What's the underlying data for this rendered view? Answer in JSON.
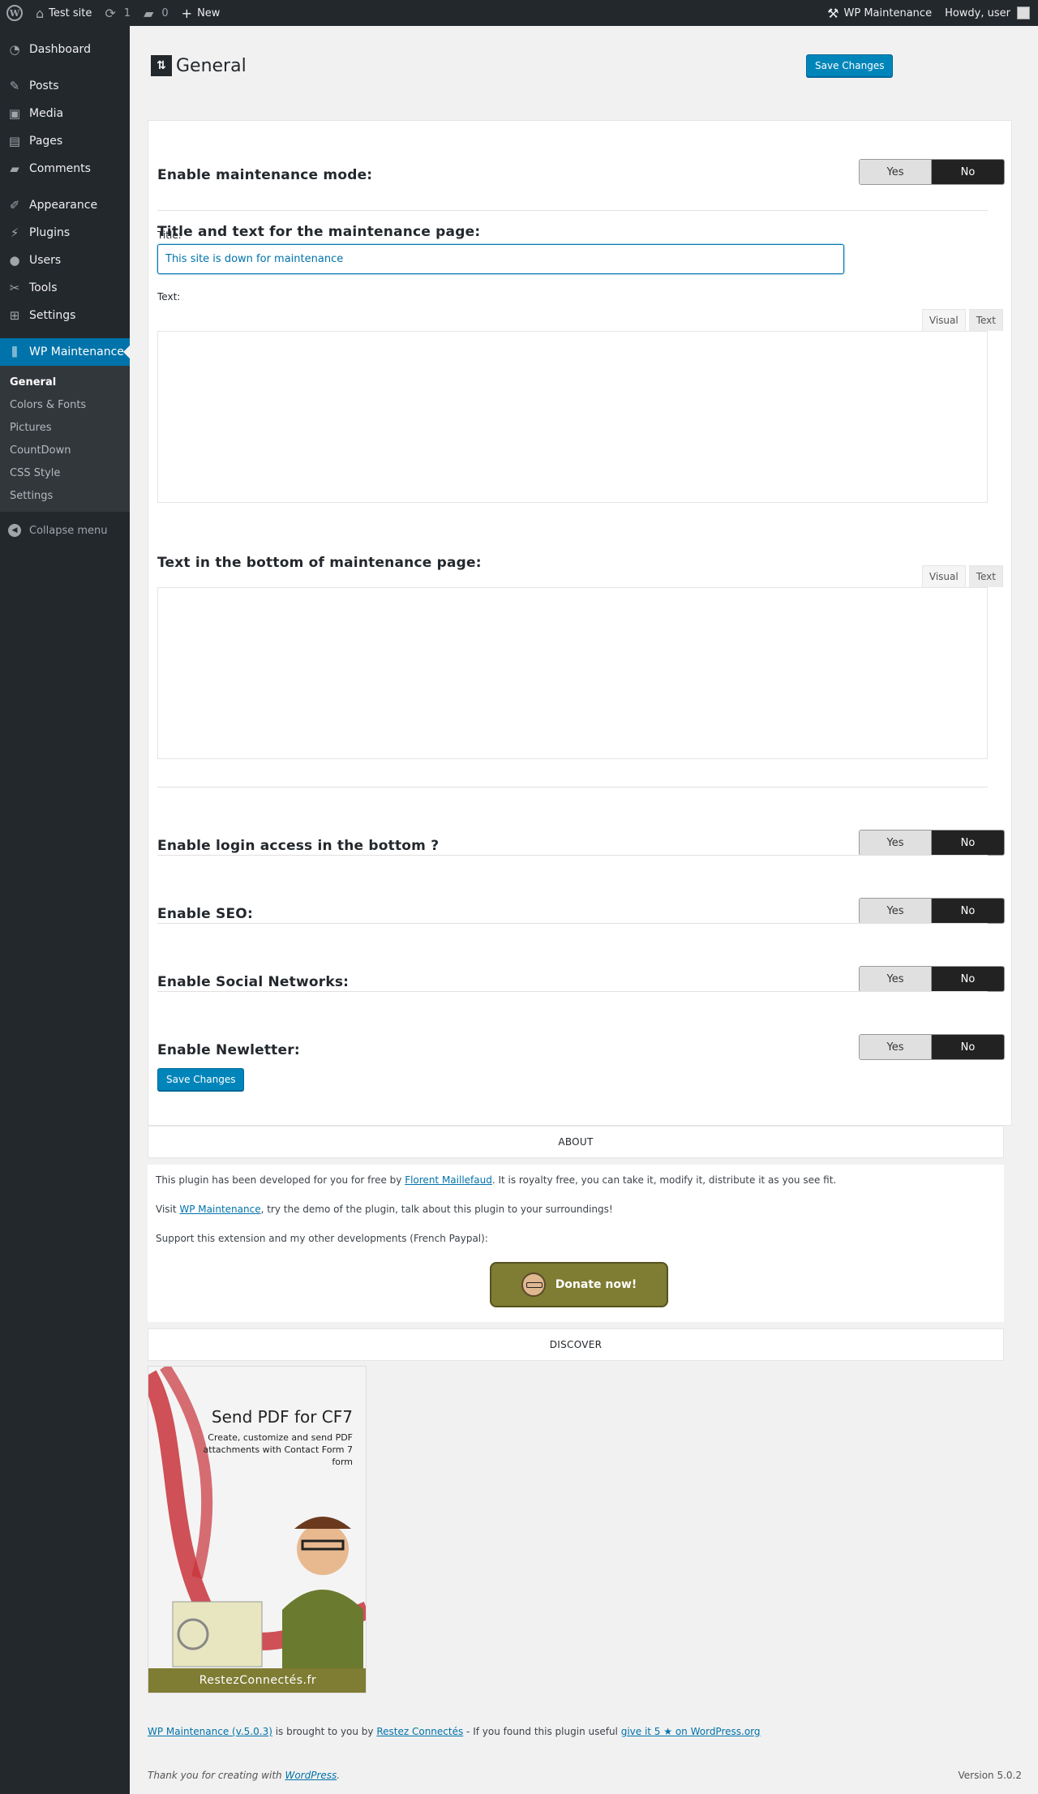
{
  "adminbar": {
    "site_name": "Test site",
    "updates_count": "1",
    "comments_count": "0",
    "new_label": "New",
    "plugin_label": "WP Maintenance",
    "howdy": "Howdy, user"
  },
  "sidebar": {
    "items": [
      {
        "label": "Dashboard",
        "icon": "dashboard-icon"
      },
      {
        "label": "Posts",
        "icon": "pin-icon"
      },
      {
        "label": "Media",
        "icon": "media-icon"
      },
      {
        "label": "Pages",
        "icon": "page-icon"
      },
      {
        "label": "Comments",
        "icon": "comment-icon"
      },
      {
        "label": "Appearance",
        "icon": "brush-icon"
      },
      {
        "label": "Plugins",
        "icon": "plug-icon"
      },
      {
        "label": "Users",
        "icon": "user-icon"
      },
      {
        "label": "Tools",
        "icon": "wrench-icon"
      },
      {
        "label": "Settings",
        "icon": "settings-icon"
      },
      {
        "label": "WP Maintenance",
        "icon": "maintenance-icon"
      }
    ],
    "submenu": [
      "General",
      "Colors & Fonts",
      "Pictures",
      "CountDown",
      "CSS Style",
      "Settings"
    ],
    "collapse_label": "Collapse menu"
  },
  "page": {
    "title": "General",
    "save_label": "Save Changes"
  },
  "settings": {
    "maintenance_mode": {
      "label": "Enable maintenance mode:",
      "yes": "Yes",
      "no": "No",
      "selected": "No"
    },
    "title_text_heading": "Title and text for the maintenance page:",
    "title_label": "Title:",
    "title_value": "This site is down for maintenance",
    "text_label": "Text:",
    "editor_tab_visual": "Visual",
    "editor_tab_text": "Text",
    "bottom_text_heading": "Text in the bottom of maintenance page:",
    "login_access": {
      "label": "Enable login access in the bottom ?",
      "yes": "Yes",
      "no": "No",
      "selected": "No"
    },
    "seo": {
      "label": "Enable SEO:",
      "yes": "Yes",
      "no": "No",
      "selected": "No"
    },
    "social": {
      "label": "Enable Social Networks:",
      "yes": "Yes",
      "no": "No",
      "selected": "No"
    },
    "newsletter": {
      "label": "Enable Newletter:",
      "yes": "Yes",
      "no": "No",
      "selected": "No"
    }
  },
  "about": {
    "heading": "ABOUT",
    "line1_pre": "This plugin has been developed for you for free by ",
    "line1_link": "Florent Maillefaud",
    "line1_post": ". It is royalty free, you can take it, modify it, distribute it as you see fit.",
    "line2_pre": "Visit ",
    "line2_link": "WP Maintenance",
    "line2_post": ", try the demo of the plugin, talk about this plugin to your surroundings!",
    "line3": "Support this extension and my other developments (French Paypal):",
    "donate_label": "Donate now!"
  },
  "discover": {
    "heading": "DISCOVER",
    "promo_title": "Send PDF for CF7",
    "promo_sub": "Create, customize and send PDF attachments with Contact Form 7 form",
    "promo_brand": "RestezConnectés.fr"
  },
  "footer": {
    "plugin_link": "WP Maintenance (v.5.0.3)",
    "brought": " is brought to you by ",
    "author_link": "Restez Connectés",
    "useful": " - If you found this plugin useful ",
    "rate_link": "give it 5 ★ on WordPress.org",
    "thanks_pre": "Thank you for creating with ",
    "thanks_link": "WordPress",
    "thanks_post": ".",
    "version": "Version 5.0.2"
  },
  "colors": {
    "accent": "#0073aa",
    "adminbar": "#23282d",
    "toggle_on": "#222222",
    "donate": "#7f7c33"
  }
}
